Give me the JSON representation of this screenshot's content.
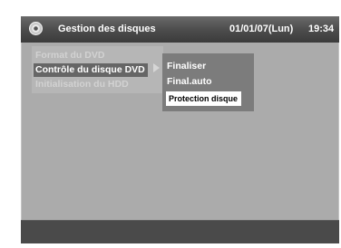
{
  "header": {
    "title": "Gestion des disques",
    "date": "01/01/07(Lun)",
    "time": "19:34",
    "icon": "disc-icon"
  },
  "menu": {
    "items": [
      {
        "label": "Format du DVD",
        "state": "disabled"
      },
      {
        "label": "Contrôle du disque DVD",
        "state": "selected"
      },
      {
        "label": "Initialisation du HDD",
        "state": "disabled"
      }
    ]
  },
  "submenu": {
    "items": [
      {
        "label": "Finaliser"
      },
      {
        "label": "Final.auto"
      },
      {
        "label": "Protection disque",
        "state": "selected"
      }
    ]
  },
  "colors": {
    "background": "#ababab",
    "header": "#4d4d4d",
    "selected": "#666666",
    "submenu": "#7c7c7c",
    "footer": "#4a4a4a"
  }
}
